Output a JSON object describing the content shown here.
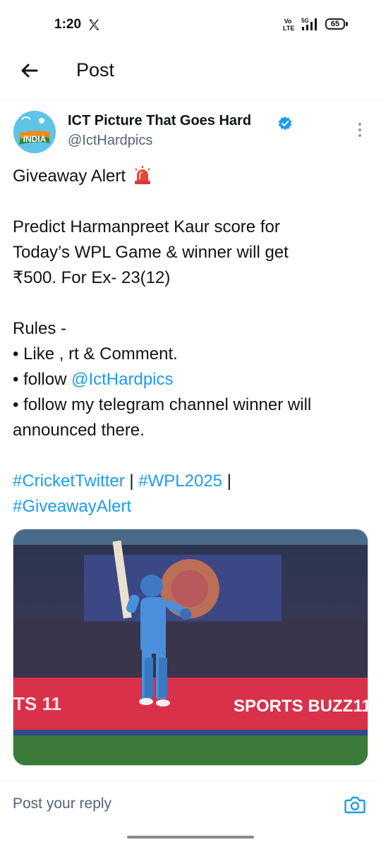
{
  "status_bar": {
    "time": "1:20",
    "network_label": "5G",
    "volte_label": "Vo\nLTE",
    "battery": "65",
    "icons": [
      "x-logo-icon",
      "signal-icon",
      "battery-icon"
    ]
  },
  "header": {
    "back_icon": "arrow-left-icon",
    "title": "Post"
  },
  "author": {
    "name": "ICT Picture That Goes Hard",
    "handle": "@IctHardpics",
    "avatar_text": "INDIA",
    "verified_icon": "verified-badge-icon",
    "more_icon": "more-vertical-icon"
  },
  "tweet": {
    "headline": "Giveaway Alert",
    "headline_icon": "siren-icon",
    "body_lines": [
      "Predict Harmanpreet Kaur score for",
      "Today’s WPL Game & winner will get",
      "₹500. For Ex- 23(12)"
    ],
    "rules_title": "Rules -",
    "rule_1": "• Like , rt & Comment.",
    "rule_2_prefix": "• follow ",
    "rule_2_mention": "@IctHardpics",
    "rule_3_lines": [
      "• follow my telegram channel winner will",
      "announced there."
    ],
    "hashtags": {
      "tag1": "#CricketTwitter",
      "sep1": " | ",
      "tag2": "#WPL2025",
      "sep2": " |",
      "tag3": "#GiveawayAlert"
    }
  },
  "media": {
    "banner_text": "SPORTS BUZZ11",
    "side_text": "TS 11"
  },
  "reply": {
    "placeholder": "Post your reply",
    "camera_icon": "camera-icon"
  },
  "colors": {
    "accent": "#1d9bf0",
    "text": "#0f1419",
    "secondary": "#536471"
  }
}
